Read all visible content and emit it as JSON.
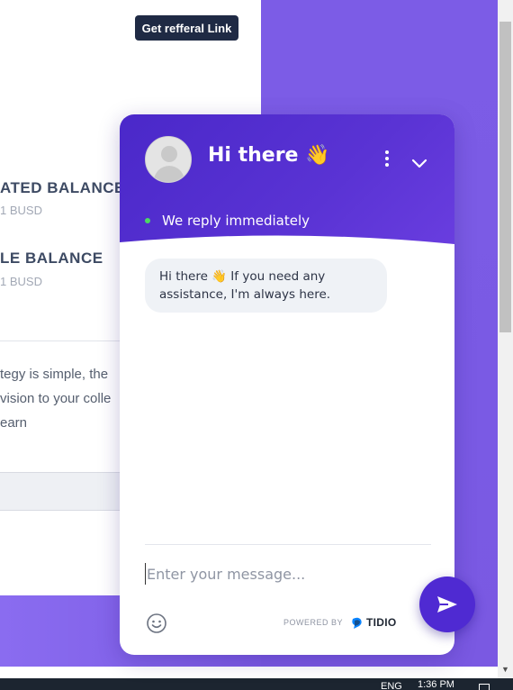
{
  "page": {
    "referral_button": "Get refferal Link",
    "balances": [
      {
        "label": "ATED BALANCE",
        "value": "1 BUSD"
      },
      {
        "label": "LE BALANCE",
        "value": "1 BUSD"
      }
    ],
    "description_lines": [
      "tegy is simple, the",
      "vision to your colle",
      "earn"
    ]
  },
  "chat": {
    "title": "Hi there 👋",
    "status": "We reply immediately",
    "message": "Hi there 👋 If you need any assistance, I'm always here.",
    "input_placeholder": "Enter your message...",
    "powered_label": "POWERED BY",
    "brand": "TIDIO"
  },
  "taskbar": {
    "language": "ENG",
    "time": "1:36 PM"
  },
  "colors": {
    "chat_header": "#4a28c9",
    "page_accent": "#7c5ce6",
    "status_online": "#4cd964",
    "send_button": "#4f2ad2"
  },
  "icons": [
    "avatar-icon",
    "more-vertical-icon",
    "chevron-down-icon",
    "emoji-icon",
    "tidio-logo-icon",
    "send-icon"
  ]
}
